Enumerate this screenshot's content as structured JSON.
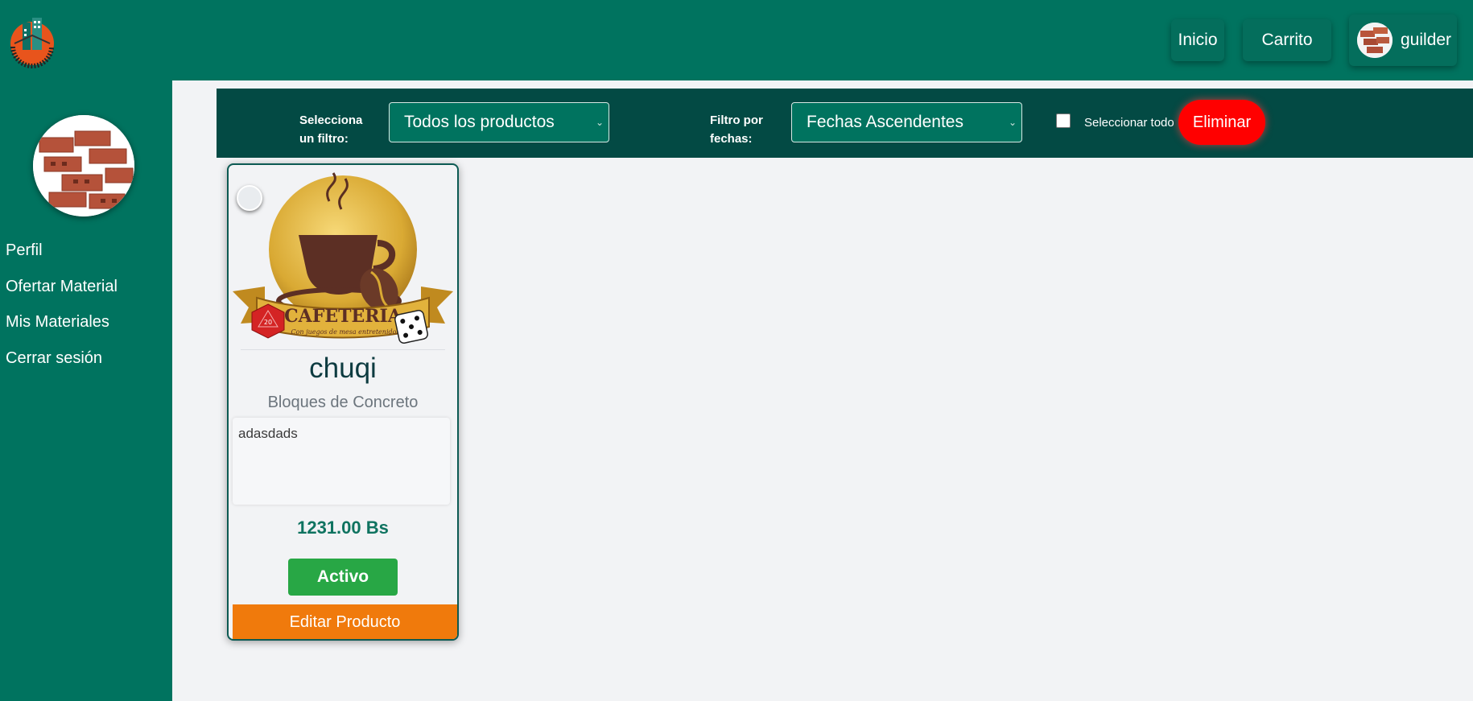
{
  "colors": {
    "primary_green": "#00735f",
    "filter_bar": "#034a44",
    "delete_red": "#ff0000",
    "active_green": "#28a745",
    "edit_orange": "#f07a0c",
    "price_green": "#0f7360"
  },
  "header": {
    "logo_icon": "brick-building-logo-icon",
    "nav": {
      "inicio": "Inicio",
      "carrito": "Carrito",
      "user_name": "guilder"
    }
  },
  "sidebar": {
    "profile_image": "bricks-photo",
    "items": [
      {
        "label": "Perfil"
      },
      {
        "label": "Ofertar Material"
      },
      {
        "label": "Mis Materiales"
      },
      {
        "label": "Cerrar sesión"
      }
    ]
  },
  "filters": {
    "filter_label_line1": "Selecciona",
    "filter_label_line2": "un filtro:",
    "filter_value": "Todos los productos",
    "date_label_line1": "Filtro por",
    "date_label_line2": "fechas:",
    "date_value": "Fechas Ascendentes",
    "select_all_label": "Seleccionar todo",
    "select_all_checked": false,
    "delete_label": "Eliminar",
    "caret_icon": "chevron-down-icon"
  },
  "products": [
    {
      "image": "cafeteria-logo",
      "image_text": "CAFETERIA",
      "image_subtext": "Con juegos de mesa entretenidos",
      "name": "chuqi",
      "category": "Bloques de Concreto",
      "description": "adasdads",
      "price": "1231.00 Bs",
      "status": "Activo",
      "edit_label": "Editar Producto"
    }
  ]
}
